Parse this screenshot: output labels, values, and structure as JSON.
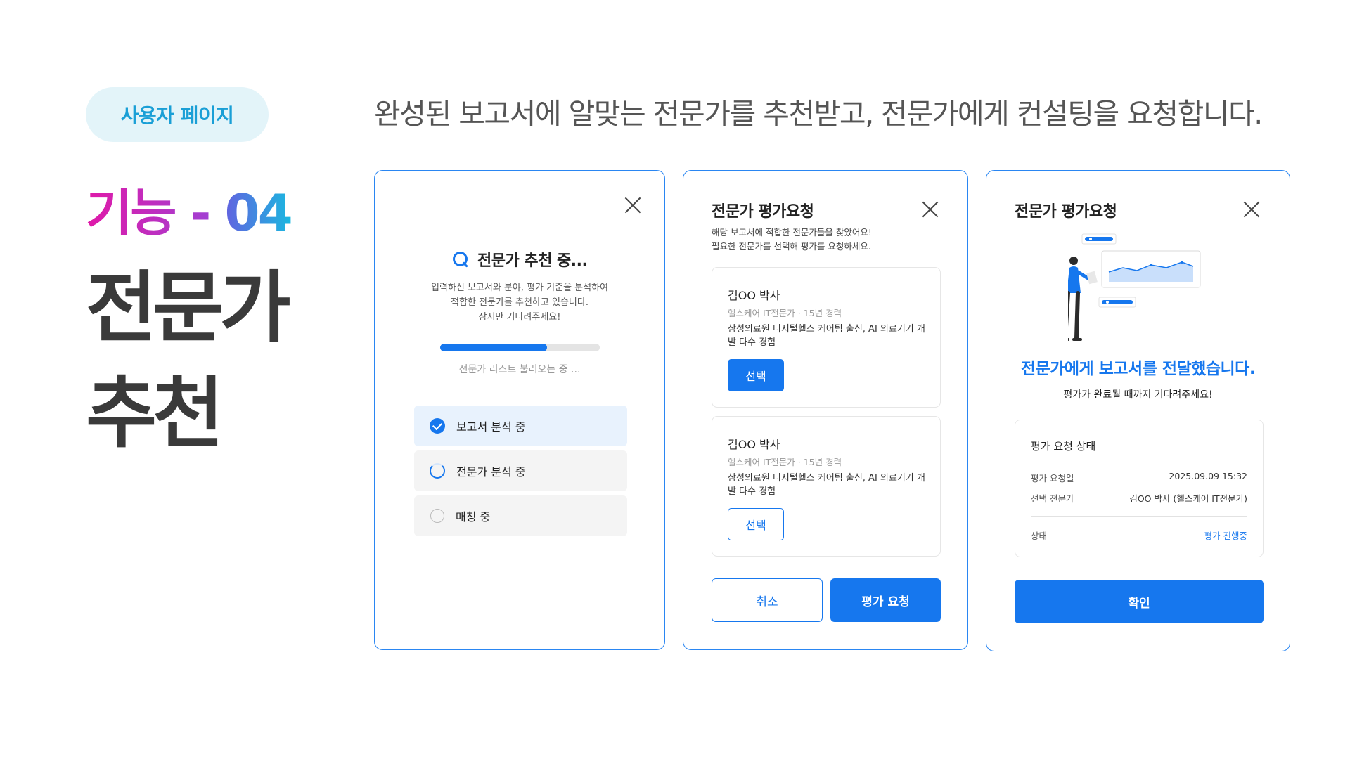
{
  "badge": "사용자 페이지",
  "feature_label": {
    "prefix": "기능 - ",
    "number": "04"
  },
  "title_lines": [
    "전문가",
    "추천"
  ],
  "headline": "완성된 보고서에 알맞는 전문가를 추천받고, 전문가에게 컨설팅을 요청합니다.",
  "panel_loading": {
    "heading": "전문가 추천 중...",
    "description": [
      "입력하신 보고서와 분야, 평가 기준을 분석하여",
      "적합한 전문가를 추천하고 있습니다.",
      "잠시만 기다려주세요!"
    ],
    "progress": 0.67,
    "progress_text": "전문가 리스트 불러오는 중 ...",
    "steps": [
      {
        "label": "보고서 분석 중",
        "status": "done"
      },
      {
        "label": "전문가 분석 중",
        "status": "in-progress"
      },
      {
        "label": "매칭 중",
        "status": "pending"
      }
    ]
  },
  "panel_select": {
    "title": "전문가 평가요청",
    "description": [
      "해당 보고서에 적합한 전문가들을 찾았어요!",
      "필요한 전문가를 선택해 평가를 요청하세요."
    ],
    "experts": [
      {
        "name": "김OO 박사",
        "role": "헬스케어 IT전문가 · 15년 경력",
        "career": "삼성의료원 디지털헬스 케어팀 출신, AI 의료기기 개발 다수 경험",
        "button": "선택",
        "selected": true
      },
      {
        "name": "김OO 박사",
        "role": "헬스케어 IT전문가 · 15년 경력",
        "career": "삼성의료원 디지털헬스 케어팀 출신, AI 의료기기 개발 다수 경험",
        "button": "선택",
        "selected": false
      }
    ],
    "cancel_label": "취소",
    "request_label": "평가 요청"
  },
  "panel_done": {
    "title": "전문가 평가요청",
    "success_title": "전문가에게 보고서를 전달했습니다.",
    "success_sub": "평가가 완료될 때까지 기다려주세요!",
    "status_card": {
      "title": "평가 요청 상태",
      "rows": [
        {
          "key": "평가 요청일",
          "value": "2025.09.09 15:32"
        },
        {
          "key": "선택 전문가",
          "value": "김OO 박사 (헬스케어 IT전문가)"
        },
        {
          "key": "상태",
          "value": "평가 진행중"
        }
      ]
    },
    "confirm_label": "확인"
  },
  "colors": {
    "primary": "#1677ee",
    "badge_bg": "#e3f4f9",
    "badge_text": "#1a9fd6",
    "title_text": "#3a3a3a"
  }
}
